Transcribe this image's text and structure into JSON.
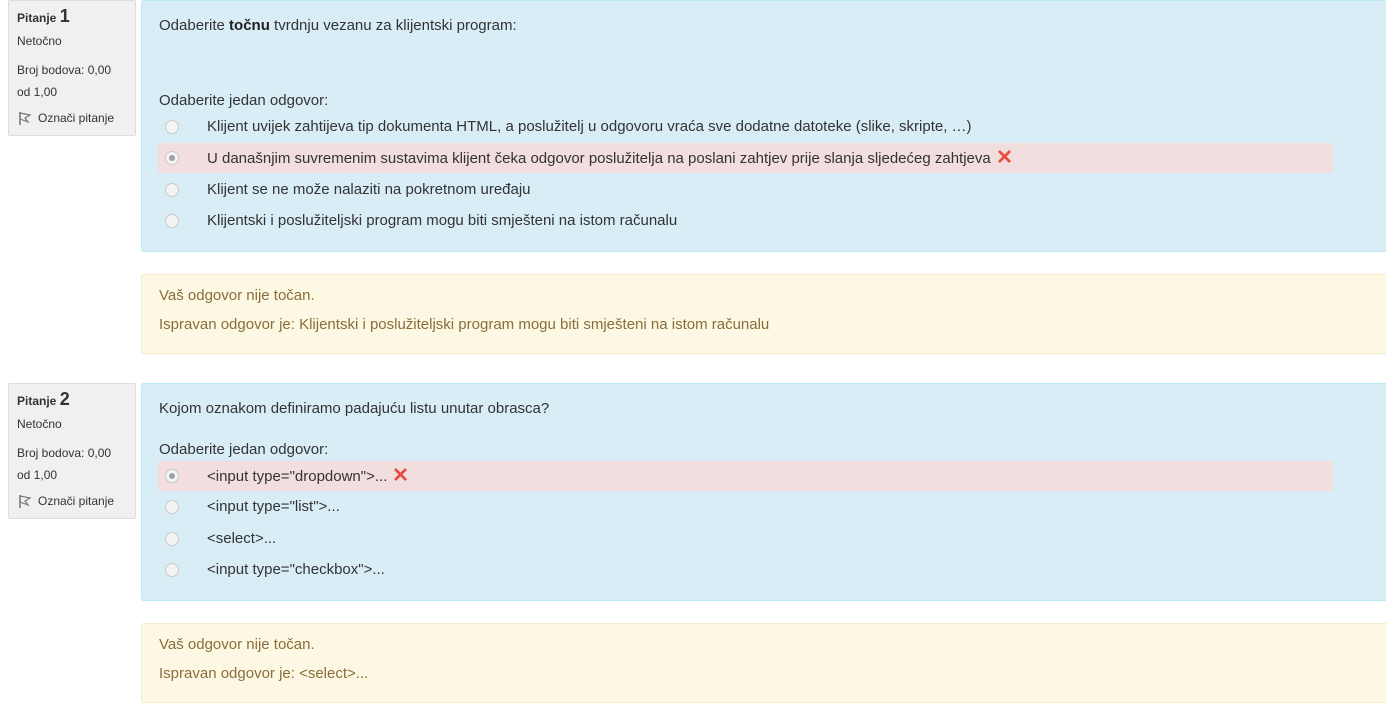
{
  "questions": [
    {
      "label": "Pitanje",
      "number": "1",
      "state": "Netočno",
      "grade_line1": "Broj bodova: 0,00",
      "grade_line2": "od 1,00",
      "flag_label": "Označi pitanje",
      "text_before": "Odaberite ",
      "text_bold": "točnu",
      "text_after": " tvrdnju vezanu za klijentski program:",
      "prompt": "Odaberite jedan odgovor:",
      "answers": [
        {
          "text": "Klijent uvijek zahtijeva tip dokumenta HTML, a poslužitelj u odgovoru vraća sve dodatne datoteke (slike, skripte, …)",
          "checked": false,
          "incorrect": false
        },
        {
          "text": "U današnjim suvremenim sustavima klijent čeka odgovor poslužitelja na poslani zahtjev prije slanja sljedećeg zahtjeva",
          "checked": true,
          "incorrect": true
        },
        {
          "text": "Klijent se ne može nalaziti na pokretnom uređaju",
          "checked": false,
          "incorrect": false
        },
        {
          "text": "Klijentski i poslužiteljski program mogu biti smješteni na istom računalu",
          "checked": false,
          "incorrect": false
        }
      ],
      "feedback": "Vaš odgovor nije točan.",
      "right_answer": "Ispravan odgovor je: Klijentski i poslužiteljski program mogu biti smješteni na istom računalu"
    },
    {
      "label": "Pitanje",
      "number": "2",
      "state": "Netočno",
      "grade_line1": "Broj bodova: 0,00",
      "grade_line2": "od 1,00",
      "flag_label": "Označi pitanje",
      "text": "Kojom oznakom definiramo padajuću listu unutar obrasca?",
      "prompt": "Odaberite jedan odgovor:",
      "answers": [
        {
          "text": "<input type=\"dropdown\">...",
          "checked": true,
          "incorrect": true
        },
        {
          "text": "<input type=\"list\">...",
          "checked": false,
          "incorrect": false
        },
        {
          "text": "<select>...",
          "checked": false,
          "incorrect": false
        },
        {
          "text": "<input type=\"checkbox\">...",
          "checked": false,
          "incorrect": false
        }
      ],
      "feedback": "Vaš odgovor nije točan.",
      "right_answer": "Ispravan odgovor je: <select>..."
    }
  ],
  "colors": {
    "formulation_bg": "#d9edf7",
    "incorrect_bg": "#f2dede",
    "outcome_bg": "#fcf8e3",
    "outcome_text": "#8a6d3b",
    "incorrect_mark": "#e74c3c"
  }
}
